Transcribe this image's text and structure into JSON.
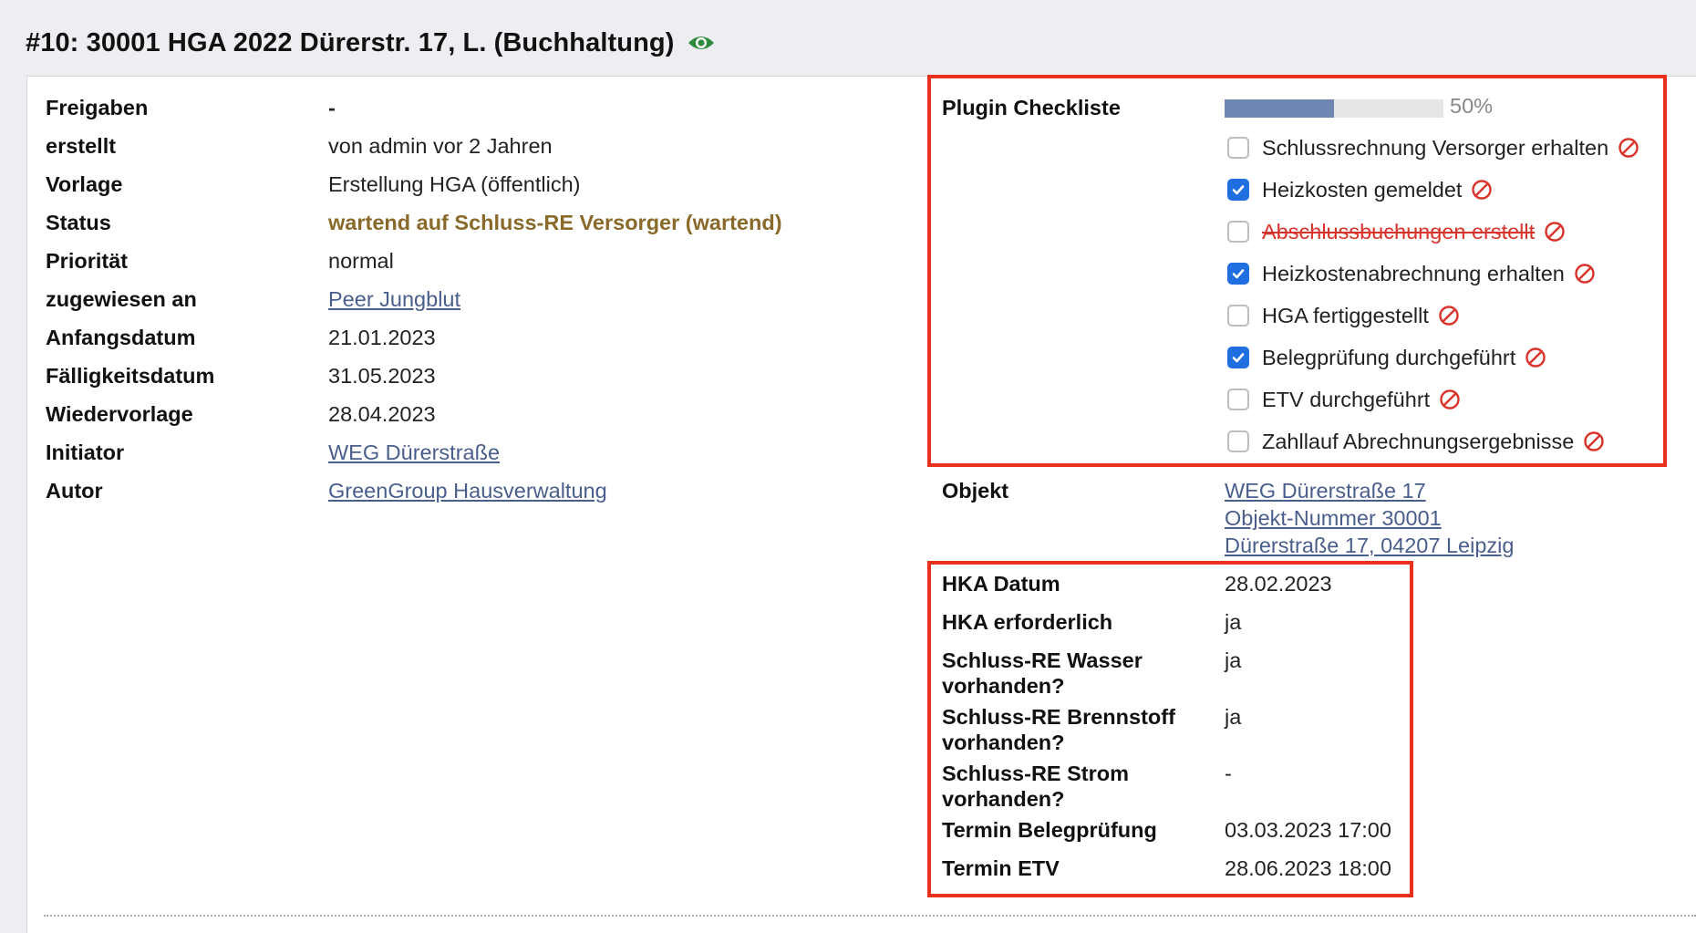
{
  "header": {
    "title": "#10: 30001 HGA 2022 Dürerstr. 17, L. (Buchhaltung)"
  },
  "details": {
    "freigaben": {
      "label": "Freigaben",
      "value": "-"
    },
    "erstellt": {
      "label": "erstellt",
      "value": "von admin vor 2 Jahren"
    },
    "vorlage": {
      "label": "Vorlage",
      "value": "Erstellung HGA (öffentlich)"
    },
    "status": {
      "label": "Status",
      "value": "wartend auf Schluss-RE Versorger (wartend)"
    },
    "prioritaet": {
      "label": "Priorität",
      "value": "normal"
    },
    "zugewiesen": {
      "label": "zugewiesen an",
      "value": "Peer Jungblut"
    },
    "anfangsdatum": {
      "label": "Anfangsdatum",
      "value": "21.01.2023"
    },
    "faelligkeitsdatum": {
      "label": "Fälligkeitsdatum",
      "value": "31.05.2023"
    },
    "wiedervorlage": {
      "label": "Wiedervorlage",
      "value": "28.04.2023"
    },
    "initiator": {
      "label": "Initiator",
      "value": "WEG Dürerstraße"
    },
    "autor": {
      "label": "Autor",
      "value": "GreenGroup Hausverwaltung"
    }
  },
  "checklist": {
    "label": "Plugin Checkliste",
    "progress_text": "50%",
    "progress_fraction": 0.5,
    "items": [
      {
        "label": "Schlussrechnung Versorger erhalten",
        "checked": false,
        "struck": false
      },
      {
        "label": "Heizkosten gemeldet",
        "checked": true,
        "struck": false
      },
      {
        "label": "Abschlussbuchungen erstellt",
        "checked": false,
        "struck": true
      },
      {
        "label": "Heizkostenabrechnung erhalten",
        "checked": true,
        "struck": false
      },
      {
        "label": "HGA fertiggestellt",
        "checked": false,
        "struck": false
      },
      {
        "label": "Belegprüfung durchgeführt",
        "checked": true,
        "struck": false
      },
      {
        "label": "ETV durchgeführt",
        "checked": false,
        "struck": false
      },
      {
        "label": "Zahllauf Abrechnungsergebnisse",
        "checked": false,
        "struck": false
      }
    ]
  },
  "objekt": {
    "label": "Objekt",
    "line1": "WEG Dürerstraße 17",
    "line2": "Objekt-Nummer 30001",
    "line3": "Dürerstraße 17, 04207 Leipzig"
  },
  "hka": {
    "datum": {
      "label": "HKA Datum",
      "value": "28.02.2023"
    },
    "erforderlich": {
      "label": "HKA erforderlich",
      "value": "ja"
    },
    "wasser": {
      "label1": "Schluss-RE Wasser",
      "label2": "vorhanden?",
      "value": "ja"
    },
    "brennstoff": {
      "label1": "Schluss-RE Brennstoff",
      "label2": "vorhanden?",
      "value": "ja"
    },
    "strom": {
      "label1": "Schluss-RE Strom",
      "label2": "vorhanden?",
      "value": "-"
    },
    "belegpruefung": {
      "label": "Termin Belegprüfung",
      "value": "03.03.2023 17:00"
    },
    "etv": {
      "label": "Termin ETV",
      "value": "28.06.2023 18:00"
    }
  },
  "colors": {
    "status": "#8a6a2a",
    "link": "#4a5e8c",
    "highlight_box": "#e8301c",
    "checkbox_checked": "#1f6fe0",
    "progress_fill": "#6f86b3",
    "forbidden_icon": "#d9342b",
    "eye_icon": "#2e8b3e"
  },
  "icons": {
    "title": "eye-icon",
    "item_action": "no-entry-icon"
  }
}
